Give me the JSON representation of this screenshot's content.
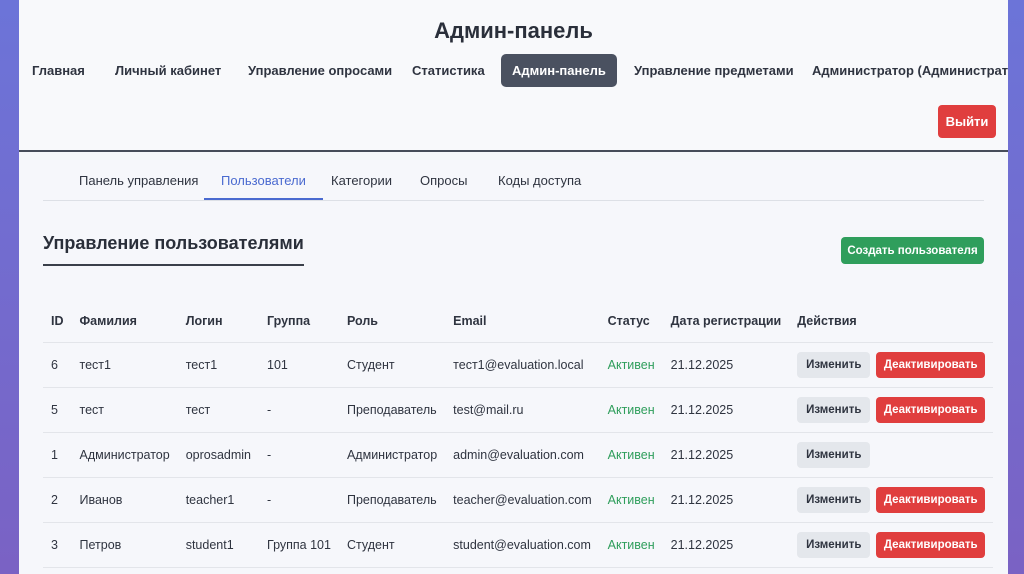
{
  "header": {
    "title": "Админ-панель",
    "nav": [
      "Главная",
      "Личный кабинет",
      "Управление опросами",
      "Статистика",
      "Админ-панель",
      "Управление предметами",
      "Администратор (Администратор)"
    ],
    "active_nav": "Админ-панель",
    "logout_label": "Выйти"
  },
  "tabs": [
    "Панель управления",
    "Пользователи",
    "Категории",
    "Опросы",
    "Коды доступа"
  ],
  "active_tab": "Пользователи",
  "section": {
    "title": "Управление пользователями",
    "create_label": "Создать пользователя"
  },
  "table": {
    "columns": [
      "ID",
      "Фамилия",
      "Логин",
      "Группа",
      "Роль",
      "Email",
      "Статус",
      "Дата регистрации",
      "Действия"
    ],
    "rows": [
      {
        "id": "6",
        "surname": "тест1",
        "login": "тест1",
        "group": "101",
        "role": "Студент",
        "email": "тест1@evaluation.local",
        "status": "Активен",
        "date": "21.12.2025",
        "edit": "Изменить",
        "deactivate": "Деактивировать"
      },
      {
        "id": "5",
        "surname": "тест",
        "login": "тест",
        "group": "-",
        "role": "Преподаватель",
        "email": "test@mail.ru",
        "status": "Активен",
        "date": "21.12.2025",
        "edit": "Изменить",
        "deactivate": "Деактивировать"
      },
      {
        "id": "1",
        "surname": "Администратор",
        "login": "oprosadmin",
        "group": "-",
        "role": "Администратор",
        "email": "admin@evaluation.com",
        "status": "Активен",
        "date": "21.12.2025",
        "edit": "Изменить",
        "deactivate": ""
      },
      {
        "id": "2",
        "surname": "Иванов",
        "login": "teacher1",
        "group": "-",
        "role": "Преподаватель",
        "email": "teacher@evaluation.com",
        "status": "Активен",
        "date": "21.12.2025",
        "edit": "Изменить",
        "deactivate": "Деактивировать"
      },
      {
        "id": "3",
        "surname": "Петров",
        "login": "student1",
        "group": "Группа 101",
        "role": "Студент",
        "email": "student@evaluation.com",
        "status": "Активен",
        "date": "21.12.2025",
        "edit": "Изменить",
        "deactivate": "Деактивировать"
      }
    ]
  },
  "colors": {
    "background_gradient": [
      "#6c74d8",
      "#7a62c4"
    ],
    "active_nav_bg": "#4a5160",
    "danger": "#e03e3e",
    "success": "#2f9e5c",
    "tab_accent": "#4a6ad0"
  }
}
